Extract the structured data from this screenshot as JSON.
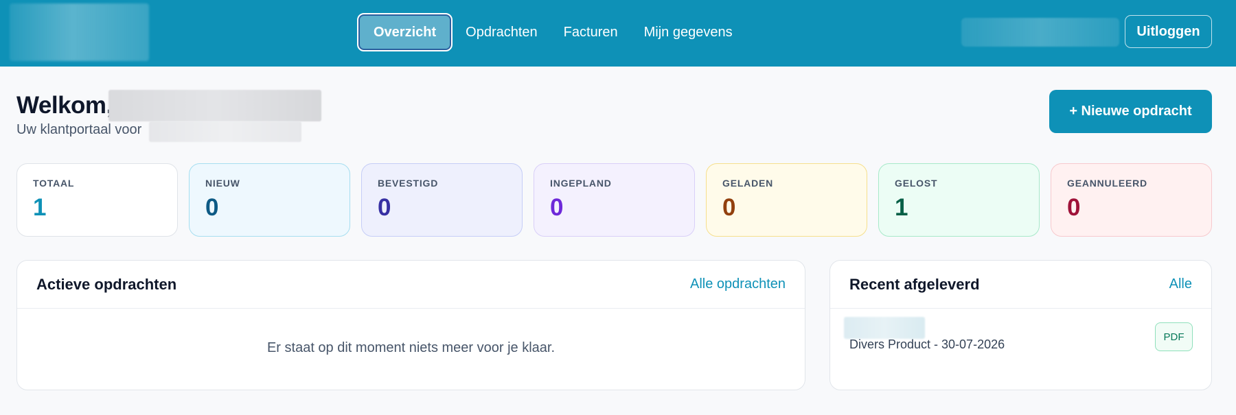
{
  "header": {
    "nav": [
      {
        "label": "Overzicht",
        "active": true
      },
      {
        "label": "Opdrachten",
        "active": false
      },
      {
        "label": "Facturen",
        "active": false
      },
      {
        "label": "Mijn gegevens",
        "active": false
      }
    ],
    "logout_label": "Uitloggen"
  },
  "welcome": {
    "title": "Welkom,",
    "subtitle": "Uw klantportaal voor"
  },
  "new_order_label": "+ Nieuwe opdracht",
  "stats": [
    {
      "label": "TOTAAL",
      "value": "1"
    },
    {
      "label": "NIEUW",
      "value": "0"
    },
    {
      "label": "BEVESTIGD",
      "value": "0"
    },
    {
      "label": "INGEPLAND",
      "value": "0"
    },
    {
      "label": "GELADEN",
      "value": "0"
    },
    {
      "label": "GELOST",
      "value": "1"
    },
    {
      "label": "GEANNULEERD",
      "value": "0"
    }
  ],
  "active_orders": {
    "title": "Actieve opdrachten",
    "link": "Alle opdrachten",
    "empty_text": "Er staat op dit moment niets meer voor je klaar."
  },
  "recent_delivered": {
    "title": "Recent afgeleverd",
    "link": "Alle",
    "items": [
      {
        "description": "Divers Product - 30-07-2026",
        "badge": "PDF"
      }
    ]
  },
  "colors": {
    "brand": "#0e91b7",
    "background": "#f8f9fb"
  }
}
